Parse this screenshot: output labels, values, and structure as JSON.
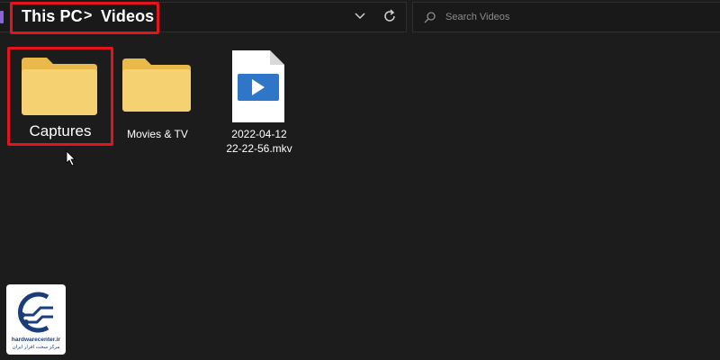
{
  "breadcrumb": {
    "items": [
      "This PC",
      "Videos"
    ],
    "separator": ">"
  },
  "search": {
    "placeholder": "Search Videos"
  },
  "items": [
    {
      "name": "Captures",
      "type": "folder",
      "selected": true
    },
    {
      "name": "Movies & TV",
      "type": "folder",
      "selected": false
    },
    {
      "name_line1": "2022-04-12",
      "name_line2": "22-22-56.mkv",
      "type": "video-file",
      "selected": false
    }
  ],
  "watermark": {
    "name": "hardwarecenter.ir",
    "subtitle": "مرکز سخت افزار ایران"
  },
  "colors": {
    "background": "#1c1c1c",
    "highlight": "#e3141c",
    "folder": "#f5d171",
    "file_icon": "#2f76c9"
  }
}
